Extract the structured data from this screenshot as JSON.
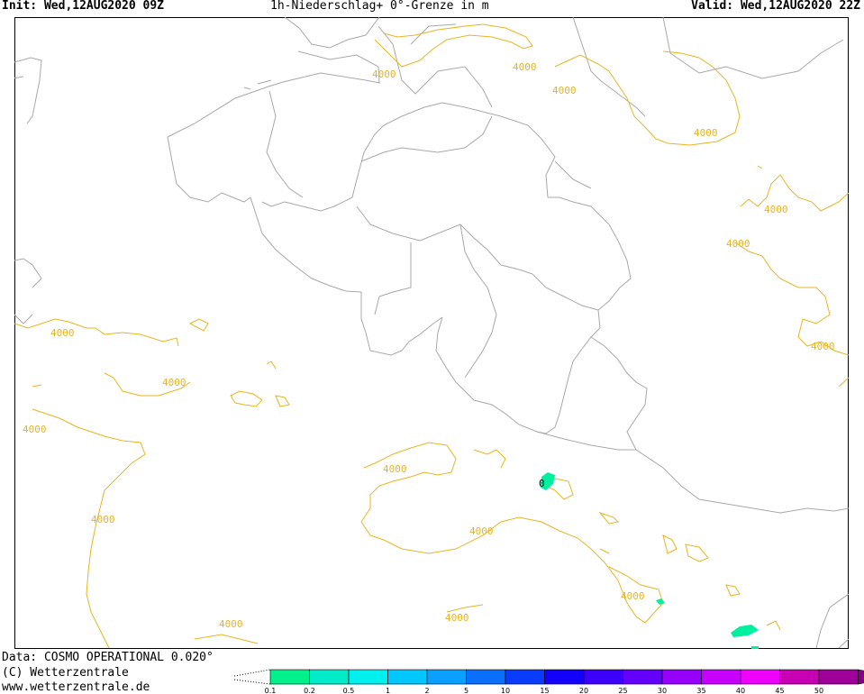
{
  "header": {
    "init": "Init: Wed,12AUG2020 09Z",
    "title": "1h-Niederschlag+ 0°-Grenze in m",
    "valid": "Valid: Wed,12AUG2020 22Z"
  },
  "footer": {
    "data_line": "Data: COSMO OPERATIONAL 0.020°",
    "copyright": "(C) Wetterzentrale",
    "website": "www.wetterzentrale.de"
  },
  "map": {
    "contour_labels": [
      "4000",
      "4000",
      "4000",
      "4000",
      "4000",
      "4000",
      "4000",
      "4000",
      "4000",
      "4000",
      "4000",
      "4000",
      "4000",
      "4000",
      "4000",
      "4000"
    ],
    "zero_label": "0",
    "colors": {
      "border": "#a8a8a8",
      "contour": "#e8b520"
    }
  },
  "legend": {
    "ticks": [
      "0.1",
      "0.2",
      "0.5",
      "1",
      "2",
      "5",
      "10",
      "15",
      "20",
      "25",
      "30",
      "35",
      "40",
      "45",
      "50"
    ],
    "colors": [
      "#00f08c",
      "#00ebc8",
      "#00f0f0",
      "#00c8ff",
      "#0aa0ff",
      "#0a6eff",
      "#0a3cff",
      "#1400ff",
      "#3c00ff",
      "#6400ff",
      "#9600ff",
      "#c800ff",
      "#f000ff",
      "#c800b4",
      "#a0009a",
      "#820082"
    ]
  }
}
